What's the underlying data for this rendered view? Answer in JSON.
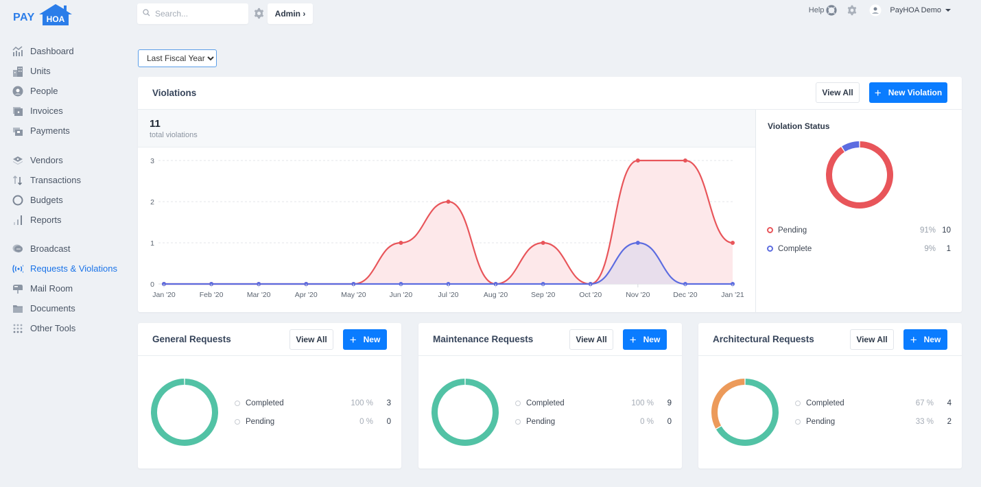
{
  "brand": {
    "pay": "PAY",
    "hoa": "HOA",
    "color": "#2b7de9"
  },
  "topbar": {
    "search_placeholder": "Search...",
    "admin_label": "Admin ›",
    "help_label": "Help",
    "user_label": "PayHOA Demo"
  },
  "sidebar": {
    "items": [
      {
        "label": "Dashboard",
        "icon": "dashboard-icon"
      },
      {
        "label": "Units",
        "icon": "building-icon"
      },
      {
        "label": "People",
        "icon": "person-icon"
      },
      {
        "label": "Invoices",
        "icon": "invoice-icon"
      },
      {
        "label": "Payments",
        "icon": "payment-icon"
      },
      {
        "label": "Vendors",
        "icon": "vendor-icon"
      },
      {
        "label": "Transactions",
        "icon": "transfer-arrows-icon"
      },
      {
        "label": "Budgets",
        "icon": "circle-icon"
      },
      {
        "label": "Reports",
        "icon": "bar-chart-icon"
      },
      {
        "label": "Broadcast",
        "icon": "chat-bubble-icon"
      },
      {
        "label": "Requests & Violations",
        "icon": "broadcast-signal-icon",
        "active": true
      },
      {
        "label": "Mail Room",
        "icon": "mailbox-icon"
      },
      {
        "label": "Documents",
        "icon": "folder-icon"
      },
      {
        "label": "Other Tools",
        "icon": "grid-dots-icon"
      }
    ]
  },
  "filter": {
    "selected": "Last Fiscal Year"
  },
  "violations": {
    "title": "Violations",
    "view_all_label": "View All",
    "new_label": "New Violation",
    "total": "11",
    "total_label": "total violations",
    "status_title": "Violation Status",
    "status": [
      {
        "label": "Pending",
        "pct": "91%",
        "count": "10",
        "value": 10,
        "color": "#e8555a"
      },
      {
        "label": "Complete",
        "pct": "9%",
        "count": "1",
        "value": 1,
        "color": "#5c6ce0"
      }
    ]
  },
  "chart_data": {
    "type": "area",
    "title": "",
    "xlabel": "",
    "ylabel": "",
    "x": [
      "Jan '20",
      "Feb '20",
      "Mar '20",
      "Apr '20",
      "May '20",
      "Jun '20",
      "Jul '20",
      "Aug '20",
      "Sep '20",
      "Oct '20",
      "Nov '20",
      "Dec '20",
      "Jan '21"
    ],
    "yticks": [
      "0",
      "1",
      "2",
      "3"
    ],
    "ylim": [
      0,
      3
    ],
    "grid": true,
    "series": [
      {
        "name": "Pending",
        "color": "#e8555a",
        "fill": "#fde8ea",
        "values": [
          0,
          0,
          0,
          0,
          0,
          1,
          2,
          0,
          1,
          0,
          3,
          3,
          1
        ]
      },
      {
        "name": "Complete",
        "color": "#5c6ce0",
        "fill": "#e4dcec",
        "values": [
          0,
          0,
          0,
          0,
          0,
          0,
          0,
          0,
          0,
          0,
          1,
          0,
          0
        ]
      }
    ]
  },
  "requests": [
    {
      "title": "General Requests",
      "view_all_label": "View All",
      "new_label": "New",
      "rows": [
        {
          "label": "Completed",
          "pct": "100 %",
          "count": "3",
          "value": 3,
          "color": "#52c2a5"
        },
        {
          "label": "Pending",
          "pct": "0 %",
          "count": "0",
          "value": 0,
          "color": "#ec9a5a"
        }
      ]
    },
    {
      "title": "Maintenance Requests",
      "view_all_label": "View All",
      "new_label": "New",
      "rows": [
        {
          "label": "Completed",
          "pct": "100 %",
          "count": "9",
          "value": 9,
          "color": "#52c2a5"
        },
        {
          "label": "Pending",
          "pct": "0 %",
          "count": "0",
          "value": 0,
          "color": "#ec9a5a"
        }
      ]
    },
    {
      "title": "Architectural Requests",
      "view_all_label": "View All",
      "new_label": "New",
      "rows": [
        {
          "label": "Completed",
          "pct": "67 %",
          "count": "4",
          "value": 4,
          "color": "#52c2a5"
        },
        {
          "label": "Pending",
          "pct": "33 %",
          "count": "2",
          "value": 2,
          "color": "#ec9a5a"
        }
      ]
    }
  ]
}
